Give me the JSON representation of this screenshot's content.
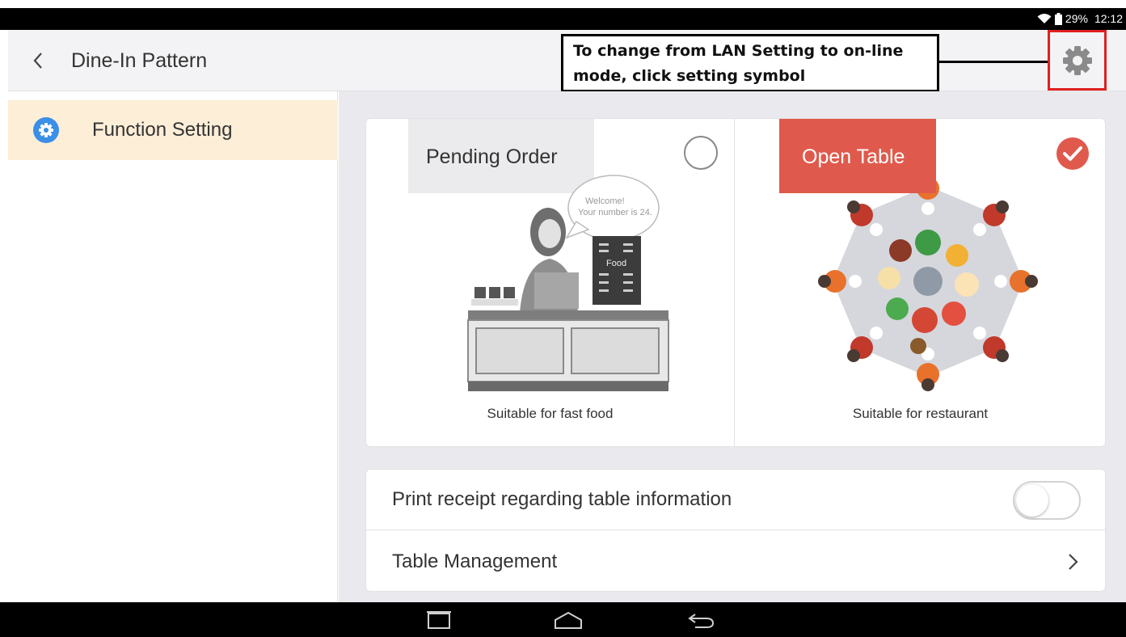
{
  "status_bar": {
    "battery": "29%",
    "time": "12:12"
  },
  "header": {
    "title": "Dine-In Pattern"
  },
  "annotation": {
    "line1": "To change from LAN Setting to on-line",
    "line2": "mode, click setting symbol"
  },
  "sidebar": {
    "items": [
      {
        "label": "Function Setting",
        "icon": "gear-icon"
      }
    ]
  },
  "patterns": [
    {
      "label": "Pending Order",
      "caption": "Suitable for fast food",
      "selected": false,
      "speech_line1": "Welcome!",
      "speech_line2": "Your number is 24.",
      "menu_board": "Food"
    },
    {
      "label": "Open Table",
      "caption": "Suitable for restaurant",
      "selected": true
    }
  ],
  "settings": [
    {
      "label": "Print receipt regarding table information",
      "toggle_on": false
    },
    {
      "label": "Table Management"
    }
  ],
  "colors": {
    "accent_red": "#df5a4c",
    "highlight": "#fdeed8",
    "sidebar_icon": "#3a8fe6"
  }
}
